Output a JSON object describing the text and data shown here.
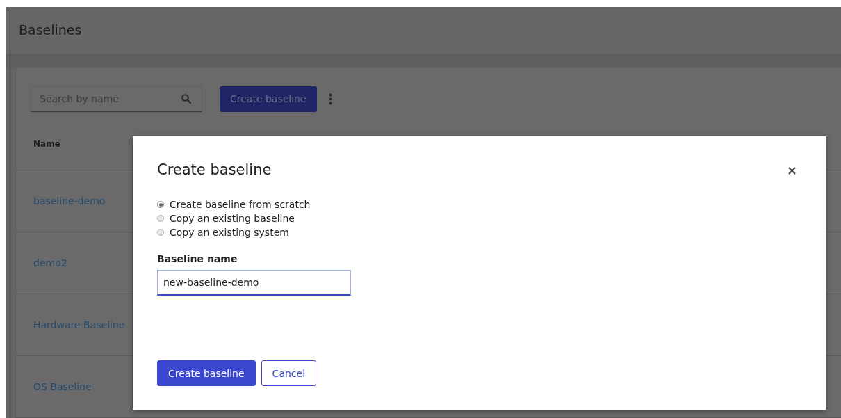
{
  "page": {
    "title": "Baselines"
  },
  "toolbar": {
    "search": {
      "placeholder": "Search by name"
    },
    "create_button": "Create baseline"
  },
  "table": {
    "columns": [
      "Name"
    ],
    "rows": [
      {
        "name": "baseline-demo"
      },
      {
        "name": "demo2"
      },
      {
        "name": "Hardware Baseline"
      },
      {
        "name": "OS Baseline"
      }
    ]
  },
  "modal": {
    "title": "Create baseline",
    "close": "×",
    "options": [
      {
        "label": "Create baseline from scratch",
        "selected": true
      },
      {
        "label": "Copy an existing baseline",
        "selected": false
      },
      {
        "label": "Copy an existing system",
        "selected": false
      }
    ],
    "field": {
      "label": "Baseline name",
      "value": "new-baseline-demo"
    },
    "buttons": [
      {
        "label": "Create baseline",
        "kind": "primary"
      },
      {
        "label": "Cancel",
        "kind": "secondary"
      }
    ]
  }
}
